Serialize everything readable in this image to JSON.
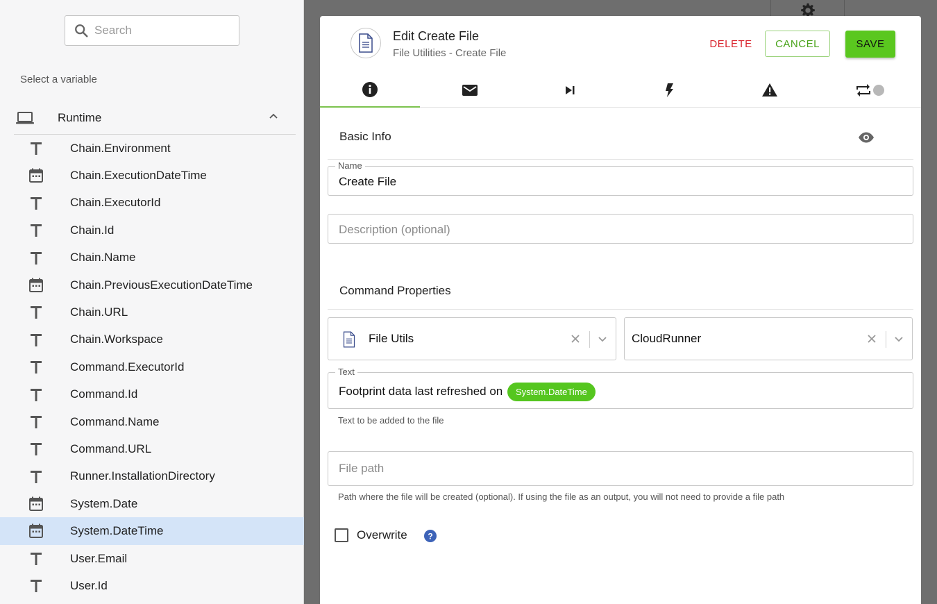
{
  "sidebar": {
    "search_placeholder": "Search",
    "select_label": "Select a variable",
    "group": {
      "label": "Runtime",
      "expanded": true
    },
    "variables": [
      {
        "label": "Chain.Environment",
        "type": "text"
      },
      {
        "label": "Chain.ExecutionDateTime",
        "type": "date"
      },
      {
        "label": "Chain.ExecutorId",
        "type": "text"
      },
      {
        "label": "Chain.Id",
        "type": "text"
      },
      {
        "label": "Chain.Name",
        "type": "text"
      },
      {
        "label": "Chain.PreviousExecutionDateTime",
        "type": "date"
      },
      {
        "label": "Chain.URL",
        "type": "text"
      },
      {
        "label": "Chain.Workspace",
        "type": "text"
      },
      {
        "label": "Command.ExecutorId",
        "type": "text"
      },
      {
        "label": "Command.Id",
        "type": "text"
      },
      {
        "label": "Command.Name",
        "type": "text"
      },
      {
        "label": "Command.URL",
        "type": "text"
      },
      {
        "label": "Runner.InstallationDirectory",
        "type": "text"
      },
      {
        "label": "System.Date",
        "type": "date"
      },
      {
        "label": "System.DateTime",
        "type": "date",
        "selected": true
      },
      {
        "label": "User.Email",
        "type": "text"
      },
      {
        "label": "User.Id",
        "type": "text"
      }
    ]
  },
  "modal": {
    "title": "Edit Create File",
    "subtitle": "File Utilities - Create File",
    "buttons": {
      "delete": "DELETE",
      "cancel": "CANCEL",
      "save": "SAVE"
    },
    "tabs": [
      "info-icon",
      "mail-icon",
      "skip-next-icon",
      "bolt-icon",
      "warning-icon",
      "repeat-icon"
    ],
    "basic_info": {
      "title": "Basic Info",
      "name_label": "Name",
      "name_value": "Create File",
      "description_placeholder": "Description (optional)"
    },
    "command_properties": {
      "title": "Command Properties",
      "connector": "File Utils",
      "runner": "CloudRunner",
      "text_label": "Text",
      "text_value": "Footprint data last refreshed on",
      "text_chip": "System.DateTime",
      "text_helper": "Text to be added to the file",
      "file_path_placeholder": "File path",
      "file_path_helper": "Path where the file will be created (optional). If using the file as an output, you will not need to provide a file path",
      "overwrite_label": "Overwrite",
      "overwrite_checked": false
    }
  },
  "colors": {
    "accent_green": "#5ac71f",
    "delete_red": "#d9232d",
    "selected_row": "#d4e4f8",
    "chip_green": "#55c61f"
  }
}
